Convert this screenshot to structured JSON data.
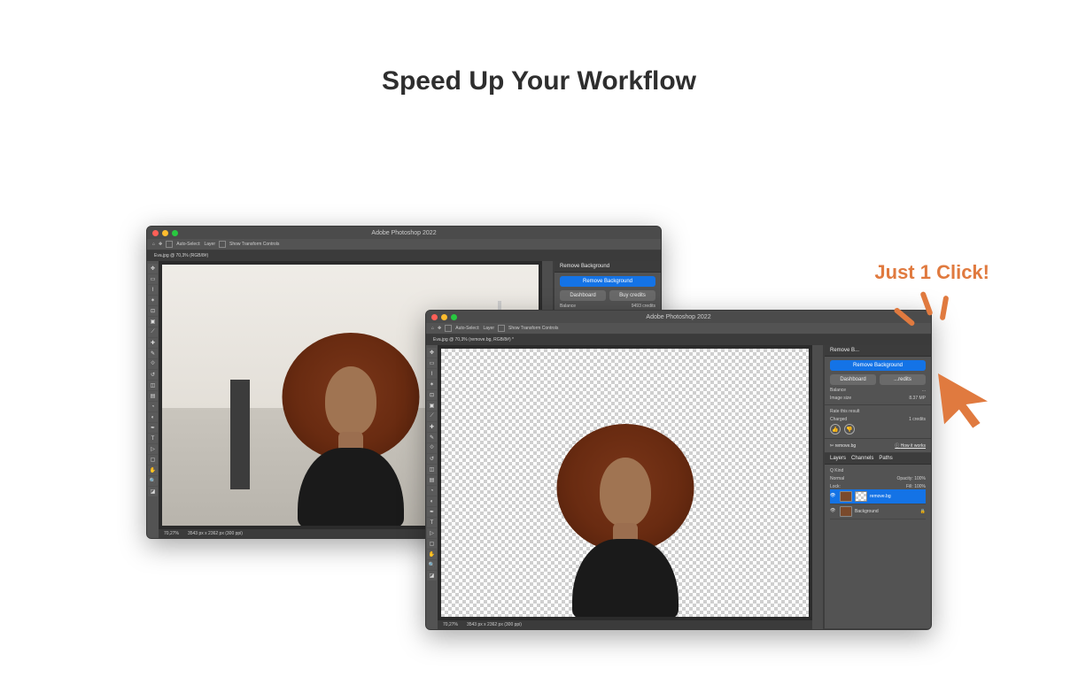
{
  "headline": "Speed Up Your Workflow",
  "callout": "Just 1 Click!",
  "accent_color": "#e07a3f",
  "app": {
    "name": "Adobe Photoshop 2022",
    "titlebar_title": "Adobe Photoshop 2022"
  },
  "options_bar": {
    "tool_icon": "move",
    "auto_select_label": "Auto-Select:",
    "auto_select_value": "Layer",
    "show_transform_label": "Show Transform Controls"
  },
  "window_back": {
    "document_tab": "Eva.jpg @ 70,3% (RGB/8#)",
    "status_zoom": "70,27%",
    "status_dims": "3543 px x 2362 px (300 ppi)",
    "panel": {
      "header": "Remove Background",
      "primary_button": "Remove Background",
      "secondary_left": "Dashboard",
      "secondary_right": "Buy credits",
      "balance_label": "Balance",
      "balance_value": "9493 credits"
    }
  },
  "window_front": {
    "document_tab": "Eva.jpg @ 70,3% (remove.bg, RGB/8#) *",
    "status_zoom": "70,27%",
    "status_dims": "3543 px x 2362 px (300 ppi)",
    "panel": {
      "header": "Remove B...",
      "primary_button": "Remove Background",
      "secondary_left": "Dashboard",
      "secondary_right": "...redits",
      "balance_label": "Balance",
      "balance_value": "...",
      "image_size_label": "Image size",
      "image_size_value": "8.37 MP",
      "rate_label": "Rate this result",
      "charged_label": "Charged",
      "charged_value": "1 credits",
      "brand": "remove.bg",
      "how_link": "How it works"
    },
    "layers_panel": {
      "tabs": [
        "Layers",
        "Channels",
        "Paths"
      ],
      "filter_label": "Q Kind",
      "blend_mode": "Normal",
      "opacity_label": "Opacity:",
      "opacity_value": "100%",
      "lock_label": "Lock:",
      "fill_label": "Fill:",
      "fill_value": "100%",
      "layers": [
        {
          "name": "remove.bg",
          "visible": true,
          "selected": true
        },
        {
          "name": "Background",
          "visible": true,
          "selected": false
        }
      ]
    }
  }
}
